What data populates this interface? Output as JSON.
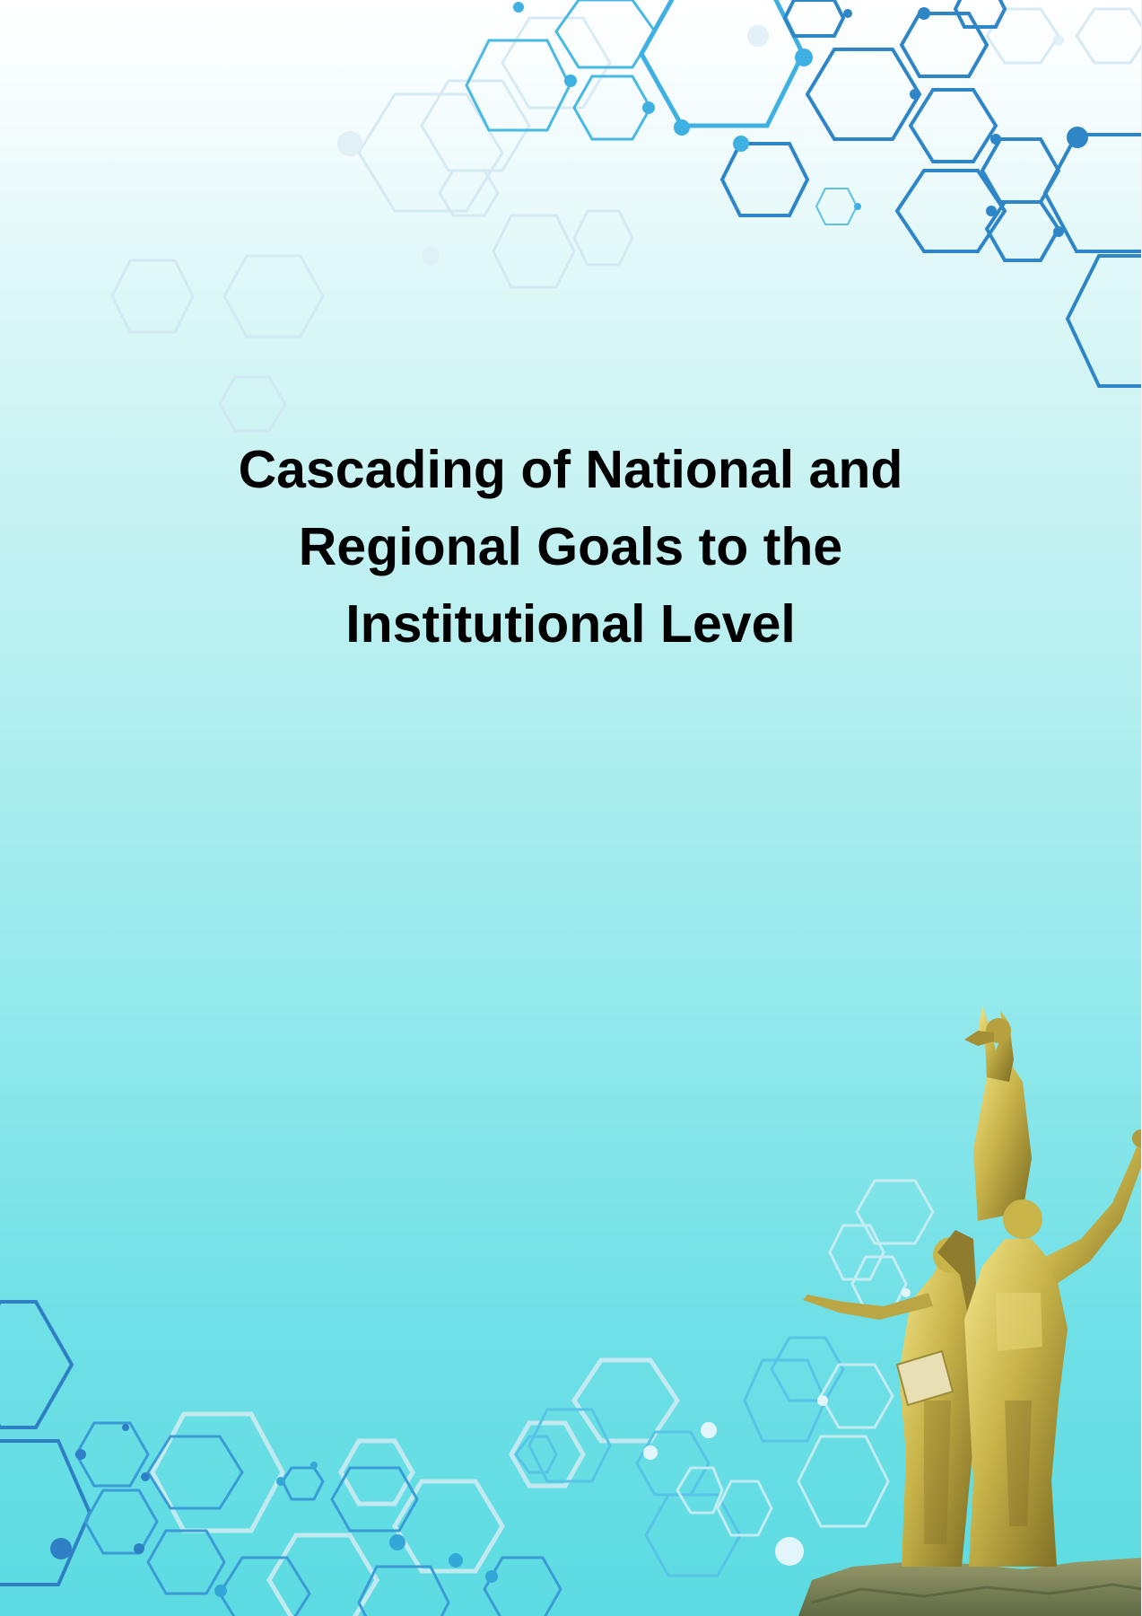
{
  "document": {
    "title_lines": [
      "Cascading of National and",
      "Regional Goals to the",
      "Institutional Level"
    ]
  },
  "decor": {
    "hexagon_pattern_icon": "hexagon-network-pattern",
    "statue_icon": "golden-monument-statue",
    "colors": {
      "background_top": "#ffffff",
      "background_bottom": "#5cdbe2",
      "hex_dark_blue": "#2f7fc4",
      "hex_light_blue": "#4cb8e6",
      "statue_gold": "#c9b44a"
    }
  }
}
